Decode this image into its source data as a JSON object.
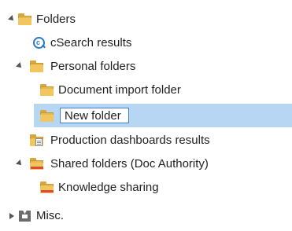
{
  "tree": {
    "folders": {
      "label": "Folders",
      "expanded": true,
      "icon": "folder-icon"
    },
    "csearch": {
      "label": "cSearch results",
      "icon": "search-results-icon"
    },
    "personal": {
      "label": "Personal folders",
      "expanded": true,
      "icon": "folder-icon"
    },
    "document_import": {
      "label": "Document import folder",
      "icon": "folder-icon"
    },
    "new_folder": {
      "value": "New folder",
      "icon": "folder-icon",
      "selected": true
    },
    "production": {
      "label": "Production dashboards results",
      "icon": "report-folder-icon"
    },
    "shared": {
      "label": "Shared folders (Doc Authority)",
      "expanded": true,
      "icon": "shared-folder-icon"
    },
    "knowledge": {
      "label": "Knowledge sharing",
      "icon": "shared-folder-icon"
    },
    "misc": {
      "label": "Misc.",
      "expanded": false,
      "icon": "misc-icon"
    }
  },
  "colors": {
    "selection": "#b7d6f3",
    "folder": "#e7b852",
    "accent": "#2b78c6"
  }
}
